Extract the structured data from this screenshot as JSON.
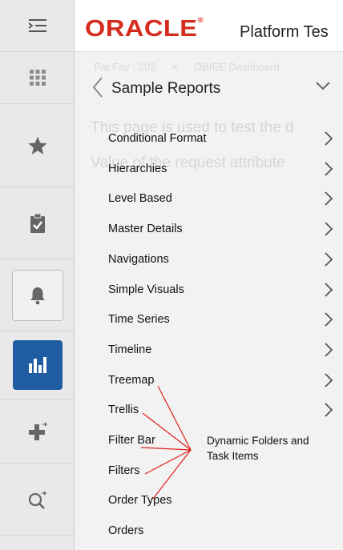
{
  "header": {
    "logo_text": "ORACLE",
    "trademark": "®",
    "app_title": "Platform Tes"
  },
  "rail": {
    "items": [
      {
        "icon": "menu-icon"
      },
      {
        "icon": "grid-icon"
      },
      {
        "icon": "star-icon"
      },
      {
        "icon": "clipboard-check-icon"
      },
      {
        "icon": "bell-icon"
      },
      {
        "icon": "bar-chart-icon"
      },
      {
        "icon": "plus-icon"
      },
      {
        "icon": "search-icon"
      }
    ]
  },
  "background": {
    "tabs": [
      "Pat Fay : 202",
      "×",
      "OBIEE Dashboard"
    ],
    "line1": "This page is used to test the d",
    "line2": "Value of the request attribute"
  },
  "panel": {
    "title": "Sample Reports",
    "items": [
      {
        "label": "Conditional Format",
        "has_chevron": true
      },
      {
        "label": "Hierarchies",
        "has_chevron": true
      },
      {
        "label": "Level Based",
        "has_chevron": true
      },
      {
        "label": "Master Details",
        "has_chevron": true
      },
      {
        "label": "Navigations",
        "has_chevron": true
      },
      {
        "label": "Simple Visuals",
        "has_chevron": true
      },
      {
        "label": "Time Series",
        "has_chevron": true
      },
      {
        "label": "Timeline",
        "has_chevron": true
      },
      {
        "label": "Treemap",
        "has_chevron": true
      },
      {
        "label": "Trellis",
        "has_chevron": true
      },
      {
        "label": "Filter Bar",
        "has_chevron": false
      },
      {
        "label": "Filters",
        "has_chevron": false
      },
      {
        "label": "Order Types",
        "has_chevron": false
      },
      {
        "label": "Orders",
        "has_chevron": false
      }
    ]
  },
  "annotation": {
    "line1": "Dynamic Folders and",
    "line2": "Task Items",
    "color": "#e02020"
  },
  "colors": {
    "brand_red": "#d52b1e",
    "active_blue": "#1f5ca1"
  }
}
